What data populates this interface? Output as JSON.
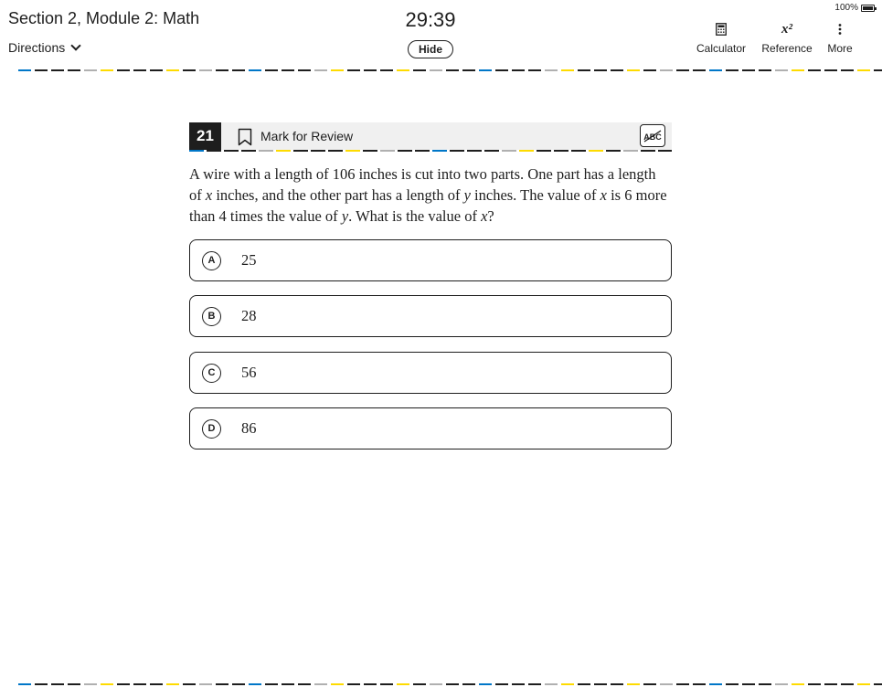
{
  "header": {
    "section_title": "Section 2, Module 2: Math",
    "directions_label": "Directions",
    "timer": "29:39",
    "hide_label": "Hide",
    "battery_text": "100%",
    "tools": {
      "calculator": {
        "label": "Calculator",
        "icon": "calculator-icon"
      },
      "reference": {
        "label": "Reference",
        "icon_text": "x²",
        "icon": "formula-reference-icon"
      },
      "more": {
        "label": "More",
        "icon": "vertical-ellipsis-icon"
      }
    }
  },
  "question": {
    "number": "21",
    "mark_for_review_label": "Mark for Review",
    "abc_label": "ABC",
    "text": {
      "p1": "A wire with a length of ",
      "n1": "106",
      "p2": " inches is cut into two parts. One part has a length of ",
      "v1": "x",
      "p3": " inches, and the other part has a length of ",
      "v2": "y",
      "p4": " inches. The value of ",
      "v3": "x",
      "p5": " is ",
      "n2": "6",
      "p6": " more than ",
      "n3": "4",
      "p7": " times the value of ",
      "v4": "y",
      "p8": ". What is the value of ",
      "v5": "x",
      "p9": "?"
    },
    "choices": [
      {
        "letter": "A",
        "text": "25"
      },
      {
        "letter": "B",
        "text": "28"
      },
      {
        "letter": "C",
        "text": "56"
      },
      {
        "letter": "D",
        "text": "86"
      }
    ]
  },
  "colors": {
    "text": "#1e1e1e",
    "dash_dark": "#1e1e1e",
    "dash_yellow": "#fedb00",
    "dash_blue": "#0077c8",
    "dash_gray": "#b0b0b0",
    "question_bar_bg": "#f0f0f0"
  }
}
